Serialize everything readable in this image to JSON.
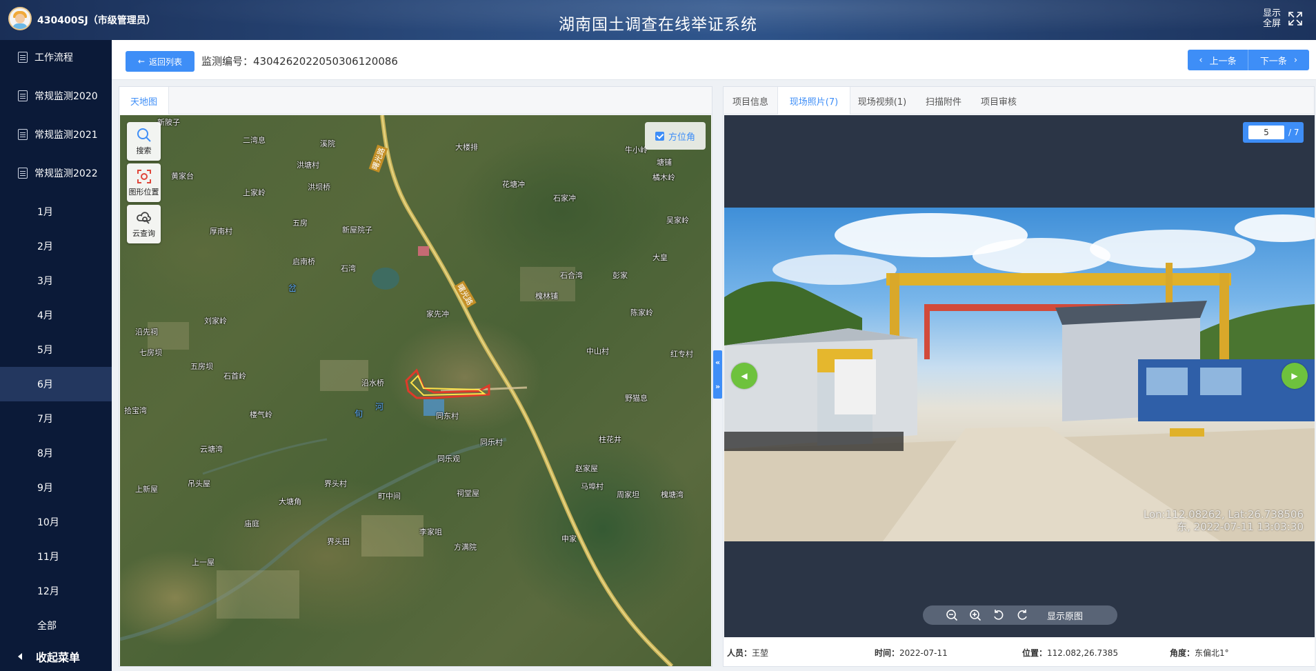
{
  "header": {
    "user": "430400SJ（市级管理员）",
    "title": "湖南国土调查在线举证系统",
    "fullscreen_line1": "显示",
    "fullscreen_line2": "全屏"
  },
  "sidebar": {
    "items": [
      {
        "label": "工作流程"
      },
      {
        "label": "常规监测2020"
      },
      {
        "label": "常规监测2021"
      },
      {
        "label": "常规监测2022"
      }
    ],
    "months": [
      "1月",
      "2月",
      "3月",
      "4月",
      "5月",
      "6月",
      "7月",
      "8月",
      "9月",
      "10月",
      "11月",
      "12月",
      "全部"
    ],
    "active_month": "6月",
    "collapse_label": "收起菜单"
  },
  "toolbar": {
    "back_label": "返回列表",
    "monitor_label": "监测编号：430426202205030612008​6",
    "prev_label": "上一条",
    "next_label": "下一条"
  },
  "map": {
    "tab_label": "天地图",
    "tools": [
      {
        "label": "搜索",
        "icon": "search-icon"
      },
      {
        "label": "图形位置",
        "icon": "shape-locate-icon"
      },
      {
        "label": "云查询",
        "icon": "cloud-query-icon"
      }
    ],
    "angle_label": "方位角",
    "road_label": "曙光路",
    "places": {
      "p1": "新陂子",
      "p2": "二湾息",
      "p3": "溪院",
      "p4": "大楼排",
      "p5": "牛小岭",
      "p6": "塘铺",
      "p7": "洪塘村",
      "p8": "黄家台",
      "p9": "洪坝桥",
      "p10": "橘木岭",
      "p11": "花塘冲",
      "p12": "上家岭",
      "p13": "石家冲",
      "p14": "五房",
      "p15": "新屋院子",
      "p16": "厚南村",
      "p17": "吴家岭",
      "p18": "启南桥",
      "p19": "石湾",
      "p20": "大皇",
      "p21": "石合湾",
      "p22": "彭家",
      "p23": "岔",
      "p24": "槐林铺",
      "p25": "刘家岭",
      "p26": "家先冲",
      "p27": "陈家岭",
      "p28": "沿先祠",
      "p29": "七房坝",
      "p30": "中山村",
      "p31": "红专村",
      "p32": "五房坝",
      "p33": "石首岭",
      "p34": "沿水桥",
      "p35": "野猫息",
      "p36": "拾宝湾",
      "p37": "楼气岭",
      "p38": "同东村",
      "p39": "河",
      "p40": "旬",
      "p41": "同乐村",
      "p42": "柱花井",
      "p43": "云塘湾",
      "p44": "同乐观",
      "p45": "赵家屋",
      "p46": "吊头屋",
      "p47": "界头村",
      "p48": "马埠村",
      "p49": "上新屋",
      "p50": "町中间",
      "p51": "祠堂屋",
      "p52": "周家坦",
      "p53": "槐塘湾",
      "p54": "大塘角",
      "p55": "庙庭",
      "p56": "李家咀",
      "p57": "界头田",
      "p58": "方满院",
      "p59": "申家",
      "p60": "上一屋"
    }
  },
  "photo": {
    "tabs": [
      "项目信息",
      "现场照片(7)",
      "现场视频(1)",
      "扫描附件",
      "项目审核"
    ],
    "active_tab": "现场照片(7)",
    "current_page": "5",
    "total_pages": "/ 7",
    "watermark_line1": "Lon:112.08262, Lat:26.738506",
    "watermark_line2": "东, 2022-07-11 13:03:30",
    "show_original": "显示原图",
    "info": {
      "person_key": "人员：",
      "person_val": "王堃",
      "time_key": "时间：",
      "time_val": "2022-07-11",
      "loc_key": "位置：",
      "loc_val": "112.082,26.7385",
      "angle_key": "角度：",
      "angle_val": "东偏北1°"
    }
  },
  "colors": {
    "accent": "#3e8ef7",
    "sidebar_bg": "#0b1a38",
    "sidebar_active": "#23375f",
    "nav_green": "#6ec23d"
  }
}
